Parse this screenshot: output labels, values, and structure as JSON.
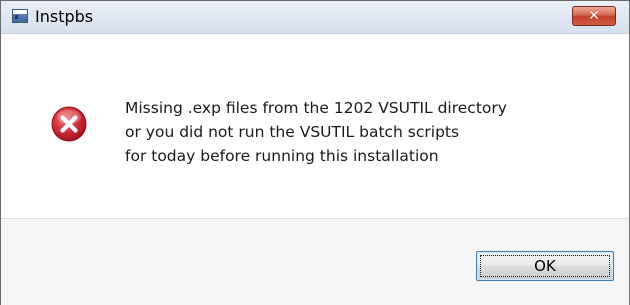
{
  "window": {
    "title": "Instpbs",
    "icon": "application-window-icon",
    "close_glyph": "✕"
  },
  "dialog": {
    "icon": "error-icon",
    "message_lines": [
      "Missing .exp files from the 1202 VSUTIL directory",
      "or you did not run the VSUTIL batch scripts",
      "for today before running this installation"
    ],
    "ok_label": "OK"
  },
  "colors": {
    "error_red": "#c0262c",
    "close_button": "#c1412a",
    "focus_border": "#3c7fb1"
  }
}
